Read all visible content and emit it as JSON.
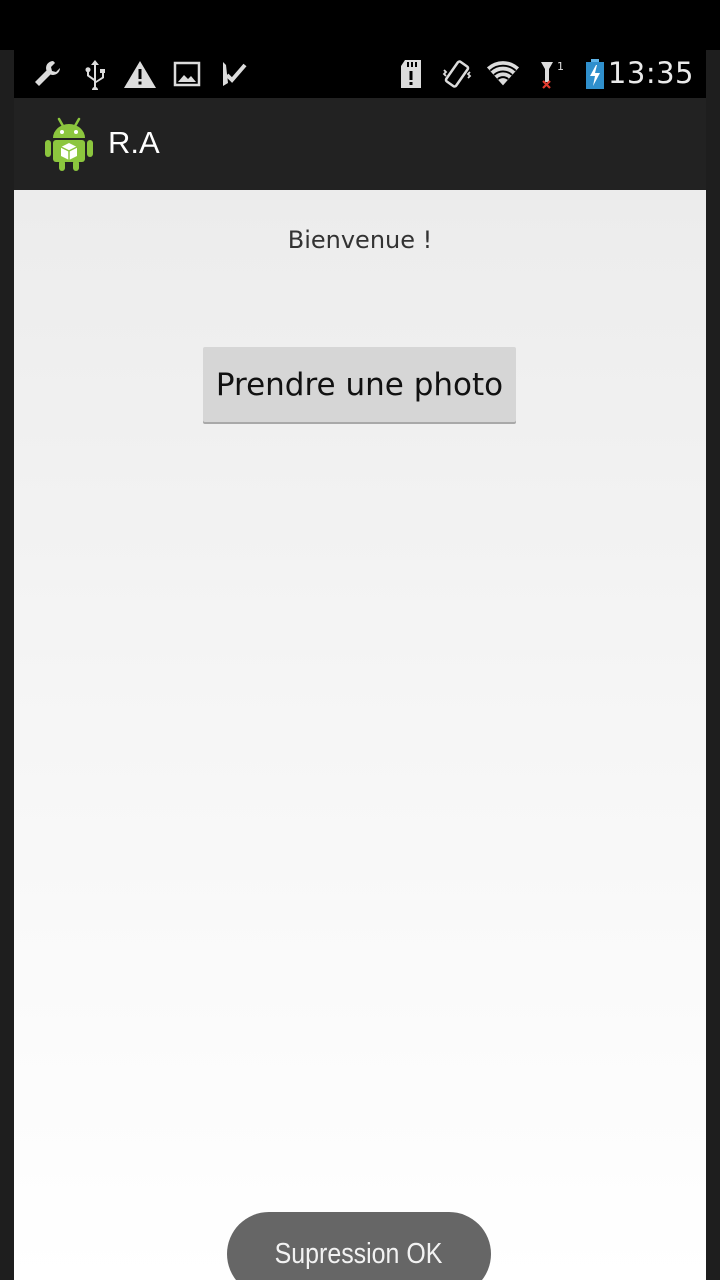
{
  "status_bar": {
    "time": "13:35",
    "left_icons": [
      "wrench-icon",
      "usb-icon",
      "warning-icon",
      "image-icon",
      "download-done-icon"
    ],
    "right_icons": [
      "sd-card-icon",
      "vibrate-icon",
      "wifi-icon",
      "signal-icon",
      "battery-charging-icon"
    ]
  },
  "action_bar": {
    "title": "R.A",
    "icon": "android-robot-icon",
    "background": "#222222"
  },
  "main": {
    "welcome_text": "Bienvenue !",
    "photo_button_label": "Prendre une photo"
  },
  "toast": {
    "message": "Supression OK"
  }
}
